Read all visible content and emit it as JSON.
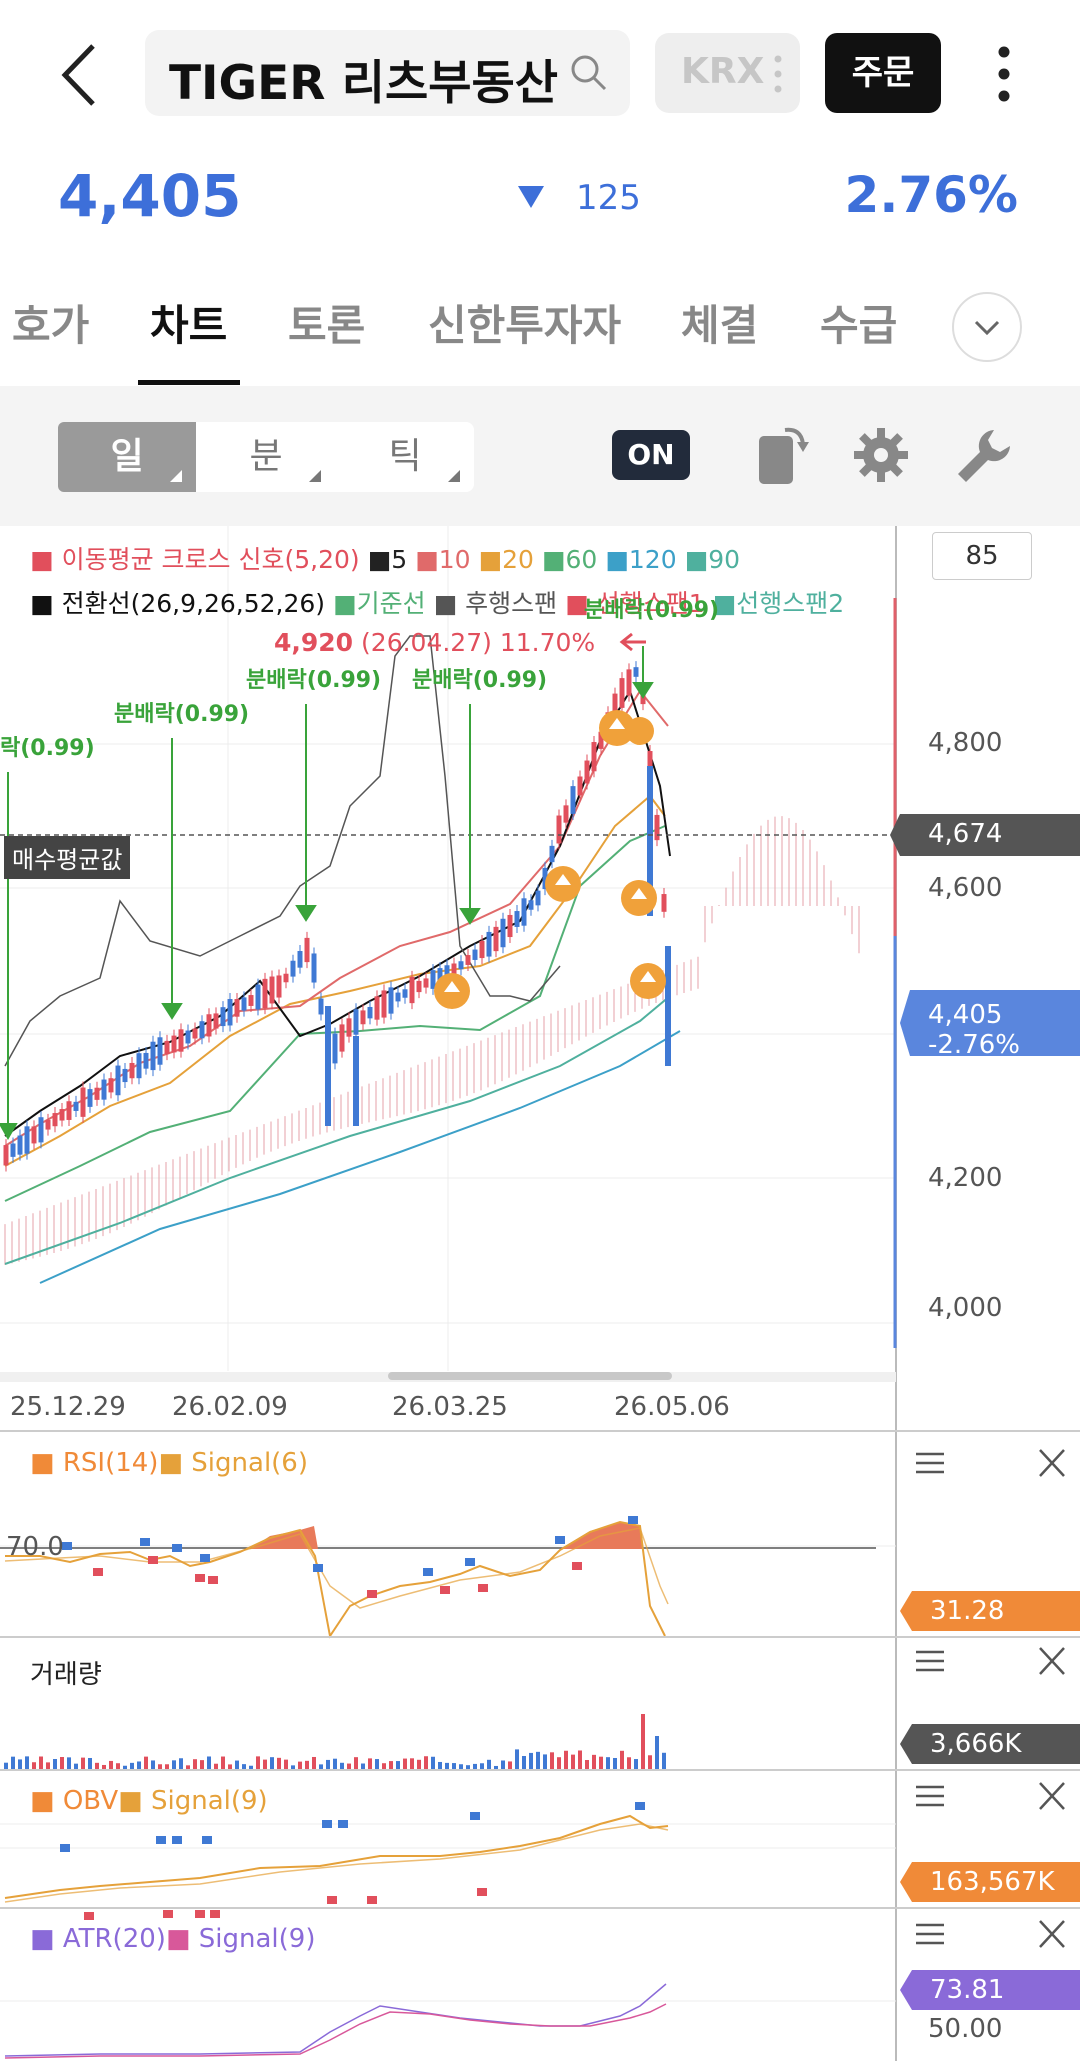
{
  "header": {
    "title": "TIGER 리츠부동산",
    "exchange": "KRX",
    "order_label": "주문"
  },
  "quote": {
    "price": "4,405",
    "change": "125",
    "change_pct": "2.76%"
  },
  "tabs": [
    {
      "label": "호가"
    },
    {
      "label": "차트"
    },
    {
      "label": "토론"
    },
    {
      "label": "신한투자자"
    },
    {
      "label": "체결"
    },
    {
      "label": "수급"
    }
  ],
  "toolbar": {
    "periods": [
      "일",
      "분",
      "틱"
    ],
    "on_label": "ON"
  },
  "chart": {
    "legend1": {
      "prefix": "이동평균 크로스 신호",
      "params": "(5,20)",
      "m5": "5",
      "m10": "10",
      "m20": "20",
      "m60": "60",
      "m120": "120",
      "m90": "90"
    },
    "legend2": {
      "a": "전환선(26,9,26,52,26)",
      "b": "기준선",
      "c": "후행스팬",
      "d": "선행스팬1",
      "e": "선행스팬2"
    },
    "box_value": "85",
    "max_annot_price": "4,920",
    "max_annot_detail": "(26.04.27) 11.70%",
    "signal_label": "분배락(0.99)",
    "signal_label_partial": "락(0.99)",
    "avg_price_label": "매수평균값",
    "y_ticks": [
      "4,800",
      "4,600",
      "4,200",
      "4,000"
    ],
    "tag_avg": "4,674",
    "tag_current": "4,405",
    "tag_current_pct": "-2.76%",
    "x_ticks": [
      "25.12.29",
      "26.02.09",
      "26.03.25",
      "26.05.06"
    ],
    "colors": {
      "up": "#e14f5c",
      "down": "#3f79d4",
      "ma10": "#e06a6a",
      "ma20": "#e5a13a",
      "ma60": "#53b076",
      "ma120": "#3ca0c8",
      "ma90": "#4fb09e",
      "signal": "#39a33a",
      "cloud": "#e6a2a8"
    }
  },
  "rsi": {
    "label1": "RSI(14)",
    "label2": "Signal(6)",
    "level": "70.0",
    "value": "31.28"
  },
  "volume": {
    "label": "거래량",
    "value": "3,666K"
  },
  "obv": {
    "label1": "OBV",
    "label2": "Signal(9)",
    "value": "163,567K"
  },
  "atr": {
    "label1": "ATR(20)",
    "label2": "Signal(9)",
    "value": "73.81",
    "tick": "50.00"
  }
}
